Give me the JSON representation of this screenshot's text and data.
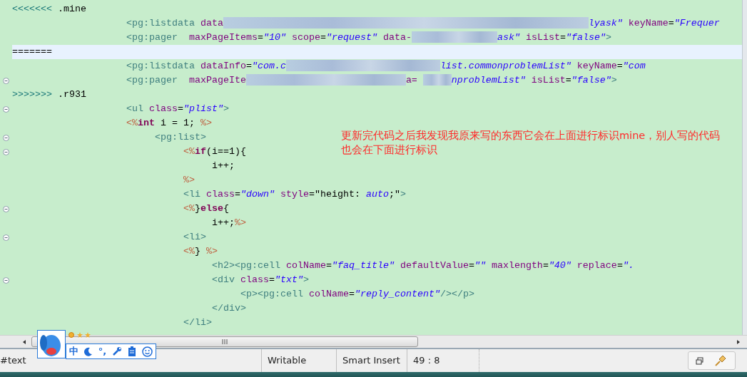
{
  "editor": {
    "lines": [
      {
        "fold": false,
        "selected": false,
        "tokens": [
          {
            "kind": "m",
            "t": "<<<<<<<"
          },
          {
            "kind": "p",
            "t": " .mine"
          }
        ]
      },
      {
        "fold": false,
        "selected": false,
        "tokens": [
          {
            "kind": "tag",
            "t": "                    <pg:listdata"
          },
          {
            "kind": "attr",
            "t": " data"
          },
          {
            "kind": "blur"
          },
          {
            "kind": "str",
            "t": "lyask\""
          },
          {
            "kind": "attr",
            "t": " keyName"
          },
          {
            "kind": "p",
            "t": "="
          },
          {
            "kind": "str",
            "t": "\"Frequer"
          }
        ]
      },
      {
        "fold": false,
        "selected": false,
        "tokens": [
          {
            "kind": "tag",
            "t": "                    <pg:pager"
          },
          {
            "kind": "attr",
            "t": "  maxPageItems"
          },
          {
            "kind": "p",
            "t": "="
          },
          {
            "kind": "str",
            "t": "\"10\""
          },
          {
            "kind": "attr",
            "t": " scope"
          },
          {
            "kind": "p",
            "t": "="
          },
          {
            "kind": "str",
            "t": "\"request\""
          },
          {
            "kind": "attr",
            "t": " data-"
          },
          {
            "kind": "blur"
          },
          {
            "kind": "str",
            "t": "ask\""
          },
          {
            "kind": "attr",
            "t": " isList"
          },
          {
            "kind": "p",
            "t": "="
          },
          {
            "kind": "str",
            "t": "\"false\""
          },
          {
            "kind": "tag",
            "t": ">"
          }
        ]
      },
      {
        "fold": false,
        "selected": true,
        "tokens": [
          {
            "kind": "p",
            "t": "======="
          }
        ]
      },
      {
        "fold": false,
        "selected": false,
        "tokens": [
          {
            "kind": "tag",
            "t": "                    <pg:listdata"
          },
          {
            "kind": "attr",
            "t": " dataInfo"
          },
          {
            "kind": "p",
            "t": "="
          },
          {
            "kind": "str",
            "t": "\"com.c"
          },
          {
            "kind": "blur"
          },
          {
            "kind": "str",
            "t": "list.commonproblemList\""
          },
          {
            "kind": "attr",
            "t": " keyName"
          },
          {
            "kind": "p",
            "t": "="
          },
          {
            "kind": "str",
            "t": "\"com"
          }
        ]
      },
      {
        "fold": true,
        "selected": false,
        "tokens": [
          {
            "kind": "tag",
            "t": "                    <pg:pager"
          },
          {
            "kind": "attr",
            "t": "  maxPageIte"
          },
          {
            "kind": "blur"
          },
          {
            "kind": "attr",
            "t": "a= "
          },
          {
            "kind": "blur"
          },
          {
            "kind": "str",
            "t": "nproblemList\""
          },
          {
            "kind": "attr",
            "t": " isList"
          },
          {
            "kind": "p",
            "t": "="
          },
          {
            "kind": "str",
            "t": "\"false\""
          },
          {
            "kind": "tag",
            "t": ">"
          }
        ]
      },
      {
        "fold": false,
        "selected": false,
        "tokens": [
          {
            "kind": "m",
            "t": ">>>>>>>"
          },
          {
            "kind": "p",
            "t": " .r931"
          }
        ]
      },
      {
        "fold": true,
        "selected": false,
        "tokens": [
          {
            "kind": "tag",
            "t": "                    <ul"
          },
          {
            "kind": "attr",
            "t": " class"
          },
          {
            "kind": "p",
            "t": "="
          },
          {
            "kind": "str",
            "t": "\"plist\""
          },
          {
            "kind": "tag",
            "t": ">"
          }
        ]
      },
      {
        "fold": false,
        "selected": false,
        "tokens": [
          {
            "kind": "jsp",
            "t": "                    <%"
          },
          {
            "kind": "kw",
            "t": "int"
          },
          {
            "kind": "p",
            "t": " i = 1; "
          },
          {
            "kind": "jsp",
            "t": "%>"
          }
        ]
      },
      {
        "fold": true,
        "selected": false,
        "tokens": [
          {
            "kind": "tag",
            "t": "                         <pg:list>"
          }
        ]
      },
      {
        "fold": true,
        "selected": false,
        "tokens": [
          {
            "kind": "jsp",
            "t": "                              <%"
          },
          {
            "kind": "kw",
            "t": "if"
          },
          {
            "kind": "p",
            "t": "(i==1){"
          }
        ]
      },
      {
        "fold": false,
        "selected": false,
        "tokens": [
          {
            "kind": "p",
            "t": "                                   i++;"
          }
        ]
      },
      {
        "fold": false,
        "selected": false,
        "tokens": [
          {
            "kind": "jsp",
            "t": "                              %>"
          }
        ]
      },
      {
        "fold": false,
        "selected": false,
        "tokens": [
          {
            "kind": "tag",
            "t": "                              <li"
          },
          {
            "kind": "attr",
            "t": " class"
          },
          {
            "kind": "p",
            "t": "="
          },
          {
            "kind": "str",
            "t": "\"down\""
          },
          {
            "kind": "attr",
            "t": " style"
          },
          {
            "kind": "p",
            "t": "=\"height: "
          },
          {
            "kind": "str",
            "t": "auto"
          },
          {
            "kind": "p",
            "t": ";\""
          },
          {
            "kind": "tag",
            "t": ">"
          }
        ]
      },
      {
        "fold": true,
        "selected": false,
        "tokens": [
          {
            "kind": "jsp",
            "t": "                              <%"
          },
          {
            "kind": "p",
            "t": "}"
          },
          {
            "kind": "kw",
            "t": "else"
          },
          {
            "kind": "p",
            "t": "{"
          }
        ]
      },
      {
        "fold": false,
        "selected": false,
        "tokens": [
          {
            "kind": "p",
            "t": "                                   i++;"
          },
          {
            "kind": "jsp",
            "t": "%>"
          }
        ]
      },
      {
        "fold": true,
        "selected": false,
        "tokens": [
          {
            "kind": "tag",
            "t": "                              <li>"
          }
        ]
      },
      {
        "fold": false,
        "selected": false,
        "tokens": [
          {
            "kind": "jsp",
            "t": "                              <%"
          },
          {
            "kind": "p",
            "t": "} "
          },
          {
            "kind": "jsp",
            "t": "%>"
          }
        ]
      },
      {
        "fold": false,
        "selected": false,
        "tokens": [
          {
            "kind": "tag",
            "t": "                                   <h2><pg:cell"
          },
          {
            "kind": "attr",
            "t": " colName"
          },
          {
            "kind": "p",
            "t": "="
          },
          {
            "kind": "str",
            "t": "\"faq_title\""
          },
          {
            "kind": "attr",
            "t": " defaultValue"
          },
          {
            "kind": "p",
            "t": "="
          },
          {
            "kind": "str",
            "t": "\"\""
          },
          {
            "kind": "attr",
            "t": " maxlength"
          },
          {
            "kind": "p",
            "t": "="
          },
          {
            "kind": "str",
            "t": "\"40\""
          },
          {
            "kind": "attr",
            "t": " replace"
          },
          {
            "kind": "p",
            "t": "="
          },
          {
            "kind": "str",
            "t": "\"."
          }
        ]
      },
      {
        "fold": true,
        "selected": false,
        "tokens": [
          {
            "kind": "tag",
            "t": "                                   <div"
          },
          {
            "kind": "attr",
            "t": " class"
          },
          {
            "kind": "p",
            "t": "="
          },
          {
            "kind": "str",
            "t": "\"txt\""
          },
          {
            "kind": "tag",
            "t": ">"
          }
        ]
      },
      {
        "fold": false,
        "selected": false,
        "tokens": [
          {
            "kind": "tag",
            "t": "                                        <p><pg:cell"
          },
          {
            "kind": "attr",
            "t": " colName"
          },
          {
            "kind": "p",
            "t": "="
          },
          {
            "kind": "str",
            "t": "\"reply_content\""
          },
          {
            "kind": "tag",
            "t": "/></p>"
          }
        ]
      },
      {
        "fold": false,
        "selected": false,
        "tokens": [
          {
            "kind": "tag",
            "t": "                                   </div>"
          }
        ]
      },
      {
        "fold": false,
        "selected": false,
        "tokens": [
          {
            "kind": "tag",
            "t": "                              </li>"
          }
        ]
      }
    ],
    "annotation": "更新完代码之后我发现我原来写的东西它会在上面进行标识mine，别人写的代码也会在下面进行标识"
  },
  "ime_toolbar": {
    "items": [
      {
        "kind": "text",
        "t": "中"
      },
      {
        "kind": "moon"
      },
      {
        "kind": "text",
        "t": "°,"
      },
      {
        "kind": "wrench"
      },
      {
        "kind": "clipboard"
      },
      {
        "kind": "smiley"
      }
    ]
  },
  "status_bar": {
    "node": "#text",
    "mode": "Writable",
    "insert": "Smart Insert",
    "position": "49 : 8"
  }
}
